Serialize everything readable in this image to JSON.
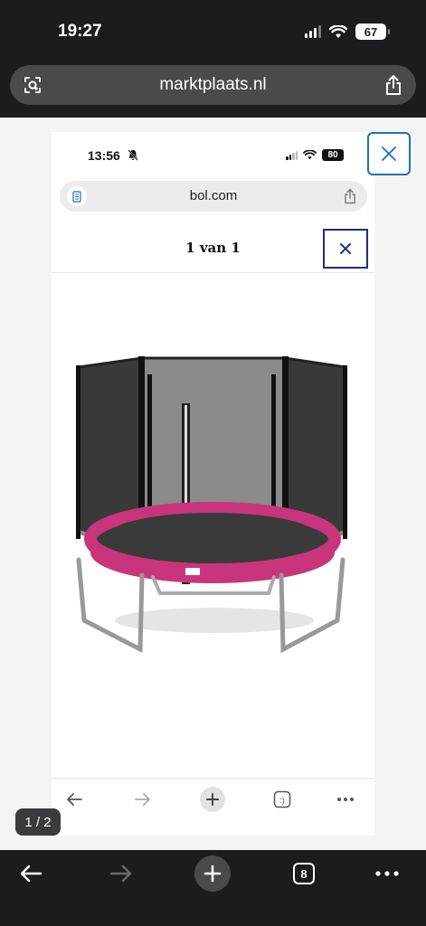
{
  "status": {
    "time": "19:27",
    "battery": "67"
  },
  "browser": {
    "url": "marktplaats.nl",
    "tabs_count": "8"
  },
  "viewer": {
    "page_counter": "1 / 2"
  },
  "inner": {
    "time": "13:56",
    "battery": "80",
    "url": "bol.com",
    "header_title": "1 van 1"
  },
  "colors": {
    "dark_bg": "#1c1c1e",
    "url_pill": "#4a4a4e",
    "content_bg": "#f4f4f4",
    "inner_close_border": "#1d2c8e",
    "outer_close_border": "#1d6fb8",
    "trampoline_pad": "#c8357a"
  },
  "icons": {
    "url_left": "page-settings-icon",
    "share": "share-icon",
    "close": "close-icon",
    "back": "arrow-left-icon",
    "forward": "arrow-right-icon",
    "new_tab": "plus-icon",
    "tabs": "tabs-icon",
    "more": "more-icon"
  }
}
